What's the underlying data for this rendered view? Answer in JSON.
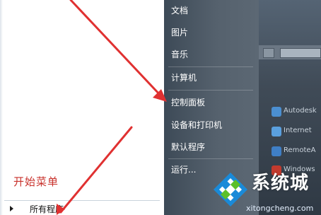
{
  "left_pane": {
    "start_menu_label": "开始菜单",
    "all_programs_label": "所有程序"
  },
  "right_pane": {
    "items": [
      {
        "label": "文档"
      },
      {
        "label": "图片"
      },
      {
        "label": "音乐"
      },
      {
        "label": "计算机"
      },
      {
        "label": "控制面板"
      },
      {
        "label": "设备和打印机"
      },
      {
        "label": "默认程序"
      },
      {
        "label": "运行..."
      }
    ]
  },
  "desktop": {
    "items": [
      {
        "label": "Autodesk",
        "icon": "autodesk-icon",
        "color": "#4b8fd1"
      },
      {
        "label": "Internet",
        "icon": "internet-icon",
        "color": "#5aa0df"
      },
      {
        "label": "RemoteA",
        "icon": "remote-icon",
        "color": "#3f7fc6"
      },
      {
        "label": "Windows",
        "icon": "windows-icon",
        "color": "#c23a2e"
      }
    ]
  },
  "watermark": {
    "title": "系统城",
    "url": "xitongcheng.com"
  },
  "colors": {
    "start_label": "#c8312b",
    "arrow": "#e03131",
    "logo_blue": "#1a8ad8",
    "logo_green": "#5bbf2a"
  }
}
